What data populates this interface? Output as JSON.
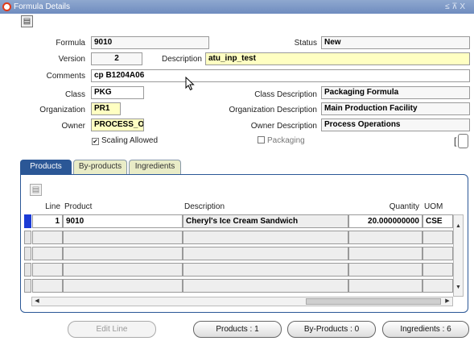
{
  "window": {
    "title": "Formula Details",
    "controls": "≤ ⊼ X"
  },
  "header": {
    "formula_label": "Formula",
    "formula_value": "9010",
    "status_label": "Status",
    "status_value": "New",
    "version_label": "Version",
    "version_value": "2",
    "description_label": "Description",
    "description_value": "atu_inp_test",
    "comments_label": "Comments",
    "comments_value": "cp B1204A06",
    "class_label": "Class",
    "class_value": "PKG",
    "class_desc_label": "Class Description",
    "class_desc_value": "Packaging Formula",
    "org_label": "Organization",
    "org_value": "PR1",
    "org_desc_label": "Organization Description",
    "org_desc_value": "Main Production Facility",
    "owner_label": "Owner",
    "owner_value": "PROCESS_O",
    "owner_desc_label": "Owner Description",
    "owner_desc_value": "Process Operations",
    "scaling_label": "Scaling Allowed",
    "scaling_checked": true,
    "packaging_label": "Packaging",
    "packaging_checked": false
  },
  "tabs": [
    {
      "label": "Products",
      "active": true
    },
    {
      "label": "By-products",
      "active": false
    },
    {
      "label": "Ingredients",
      "active": false
    }
  ],
  "grid": {
    "columns": {
      "line": "Line",
      "product": "Product",
      "description": "Description",
      "quantity": "Quantity",
      "uom": "UOM"
    },
    "rows": [
      {
        "line": "1",
        "product": "9010",
        "description": "Cheryl's Ice Cream Sandwich",
        "quantity": "20.000000000",
        "uom": "CSE"
      }
    ]
  },
  "buttons": {
    "edit_line": "Edit Line",
    "products": "Products : 1",
    "by_products": "By-Products : 0",
    "ingredients": "Ingredients : 6"
  }
}
